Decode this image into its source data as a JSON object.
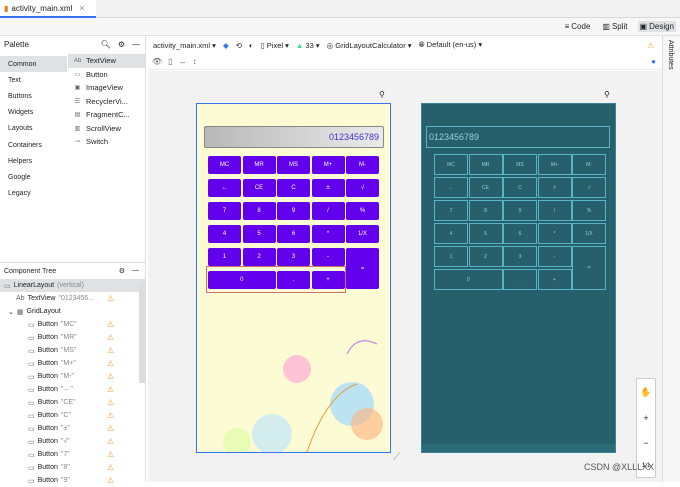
{
  "tab": {
    "file": "activity_main.xml",
    "close": "×"
  },
  "view_modes": [
    "Code",
    "Split",
    "Design"
  ],
  "palette": {
    "title": "Palette",
    "categories": [
      "Common",
      "Text",
      "Buttons",
      "Widgets",
      "Layouts",
      "Containers",
      "Helpers",
      "Google",
      "Legacy"
    ],
    "widgets": [
      {
        "icon": "Ab",
        "label": "TextView"
      },
      {
        "icon": "▭",
        "label": "Button"
      },
      {
        "icon": "▣",
        "label": "ImageView"
      },
      {
        "icon": "☰",
        "label": "RecyclerVi..."
      },
      {
        "icon": "▤",
        "label": "FragmentC..."
      },
      {
        "icon": "▥",
        "label": "ScrollView"
      },
      {
        "icon": "⊸",
        "label": "Switch"
      }
    ]
  },
  "toolbar": {
    "file": "activity_main.xml ▾",
    "device": "Pixel ▾",
    "api": "33 ▾",
    "theme": "GridLayoutCalculator ▾",
    "locale": "Default (en-us) ▾"
  },
  "tree": {
    "title": "Component Tree",
    "nodes": [
      {
        "label": "LinearLayout",
        "dim": "(vertical)",
        "warn": ""
      },
      {
        "label": "TextView",
        "dim": "\"0123456...",
        "warn": "⚠"
      },
      {
        "label": "GridLayout",
        "dim": "",
        "warn": ""
      },
      {
        "label": "Button",
        "dim": "\"MC\"",
        "warn": "⚠"
      },
      {
        "label": "Button",
        "dim": "\"MR\"",
        "warn": "⚠"
      },
      {
        "label": "Button",
        "dim": "\"MS\"",
        "warn": "⚠"
      },
      {
        "label": "Button",
        "dim": "\"M+\"",
        "warn": "⚠"
      },
      {
        "label": "Button",
        "dim": "\"M-\"",
        "warn": "⚠"
      },
      {
        "label": "Button",
        "dim": "\"←\"",
        "warn": "⚠"
      },
      {
        "label": "Button",
        "dim": "\"CE\"",
        "warn": "⚠"
      },
      {
        "label": "Button",
        "dim": "\"C\"",
        "warn": "⚠"
      },
      {
        "label": "Button",
        "dim": "\"±\"",
        "warn": "⚠"
      },
      {
        "label": "Button",
        "dim": "\"√\"",
        "warn": "⚠"
      },
      {
        "label": "Button",
        "dim": "\"7\"",
        "warn": "⚠"
      },
      {
        "label": "Button",
        "dim": "\"8\"",
        "warn": "⚠"
      },
      {
        "label": "Button",
        "dim": "\"9\"",
        "warn": "⚠"
      }
    ]
  },
  "attributes": "Attributes",
  "calculator": {
    "display": "0123456789",
    "keys": [
      "MC",
      "MR",
      "MS",
      "M+",
      "M-",
      "←",
      "CE",
      "C",
      "±",
      "√",
      "7",
      "8",
      "9",
      "/",
      "%",
      "4",
      "5",
      "6",
      "*",
      "1/X",
      "1",
      "2",
      "3",
      "-",
      "=",
      "0",
      ".",
      "+"
    ]
  },
  "zoom": [
    "✋",
    "+",
    "−",
    "1:1"
  ],
  "watermark": "CSDN @XLLLXX"
}
